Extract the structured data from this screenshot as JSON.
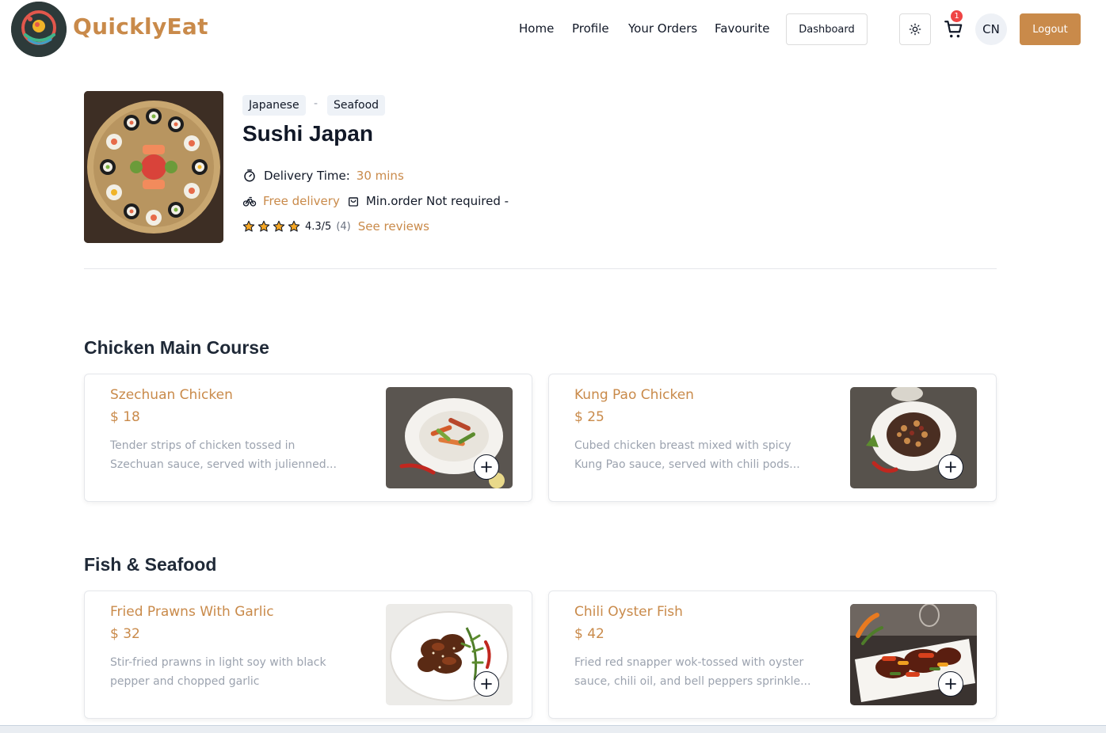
{
  "brand": {
    "name": "QuicklyEat"
  },
  "nav": {
    "items": [
      "Home",
      "Profile",
      "Your Orders",
      "Favourite"
    ],
    "dashboard_label": "Dashboard",
    "theme_icon": "sun-icon",
    "cart_icon": "cart-icon",
    "cart_count": "1",
    "avatar_initials": "CN",
    "logout_label": "Logout"
  },
  "restaurant": {
    "tags": [
      "Japanese",
      "Seafood"
    ],
    "tag_separator": "-",
    "name": "Sushi Japan",
    "delivery_time_label": "Delivery Time:",
    "delivery_time_value": "30 mins",
    "free_delivery": "Free delivery",
    "min_order": "Min.order Not required -",
    "rating": "4.3/5",
    "rating_count": "(4)",
    "stars": 4,
    "see_reviews": "See reviews"
  },
  "sections": [
    {
      "title": "Chicken Main Course",
      "items": [
        {
          "name": "Szechuan Chicken",
          "price": "$ 18",
          "desc_lines": [
            "Tender strips of chicken tossed in",
            "Szechuan sauce, served with julienned..."
          ]
        },
        {
          "name": "Kung Pao Chicken",
          "price": "$ 25",
          "desc_lines": [
            "Cubed chicken breast mixed with spicy",
            "Kung Pao sauce, served with chili pods..."
          ]
        }
      ]
    },
    {
      "title": "Fish & Seafood",
      "items": [
        {
          "name": "Fried Prawns With Garlic",
          "price": "$ 32",
          "desc_lines": [
            "Stir-fried prawns in light soy with black",
            "pepper and chopped garlic"
          ]
        },
        {
          "name": "Chili Oyster Fish",
          "price": "$ 42",
          "desc_lines": [
            "Fried red snapper wok-tossed with oyster",
            "sauce, chili oil, and bell peppers sprinkle..."
          ]
        }
      ]
    }
  ],
  "colors": {
    "accent": "#c98a4a",
    "badge": "#ef4444"
  }
}
